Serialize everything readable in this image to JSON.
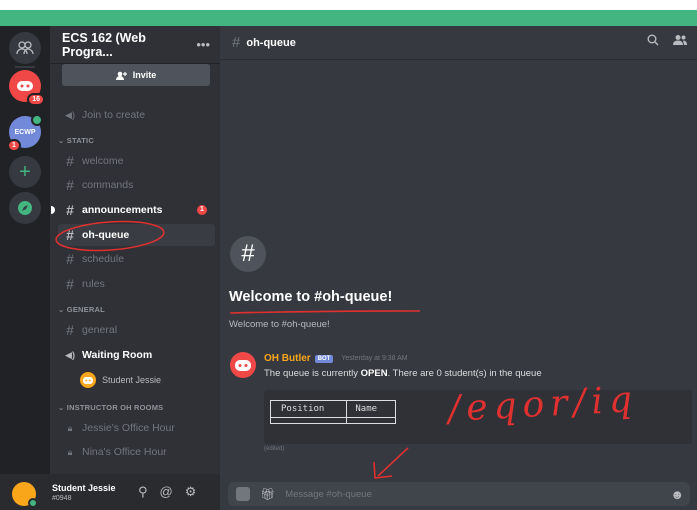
{
  "server": {
    "name": "ECS 162 (Web Progra...",
    "invite_label": "Invite",
    "rail": {
      "red_badge": "16",
      "ecs_initials": "ECWP",
      "ecs_badge": "1"
    }
  },
  "channels": {
    "voice_join": "Join to create",
    "cat_static": "STATIC",
    "welcome": "welcome",
    "commands": "commands",
    "announcements": "announcements",
    "announcements_badge": "1",
    "oh_queue": "oh-queue",
    "schedule": "schedule",
    "rules": "rules",
    "cat_general": "GENERAL",
    "general": "general",
    "waiting_room": "Waiting Room",
    "waiting_member": "Student Jessie",
    "cat_instructor": "INSTRUCTOR OH ROOMS",
    "office1": "Jessie's Office Hour",
    "office2": "Nina's Office Hour"
  },
  "user": {
    "name": "Student Jessie",
    "tag": "#0948"
  },
  "main": {
    "channel_title": "oh-queue",
    "welcome_title": "Welcome to #oh-queue!",
    "welcome_sub": "Welcome to #oh-queue!",
    "message": {
      "author": "OH Butler",
      "bot_tag": "BOT",
      "timestamp": "Yesterday at 9:38 AM",
      "text_pre": "The queue is currently ",
      "text_bold": "OPEN",
      "text_post": ". There are 0 student(s) in the queue",
      "table_headers": [
        "Position",
        "Name"
      ],
      "edited": "(edited)"
    },
    "composer_placeholder": "Message #oh-queue"
  },
  "annotations": {
    "handwritten": "/eqor/iq",
    "color": "#e03030"
  },
  "colors": {
    "accent": "#43b581",
    "danger": "#f04747",
    "blurple": "#7289da",
    "bot_author": "#faa61a"
  }
}
